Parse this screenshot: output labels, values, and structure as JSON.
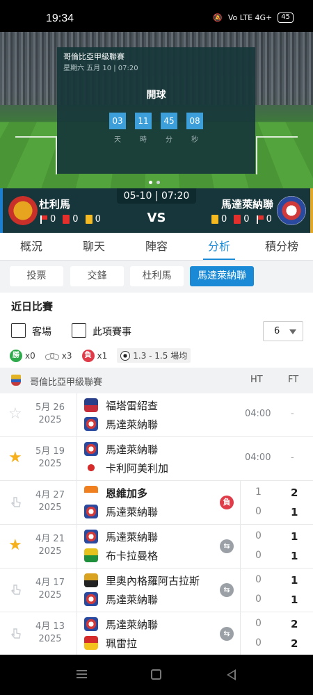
{
  "status": {
    "time": "19:34",
    "battery": "45",
    "signal": "Vo LTE 4G+"
  },
  "hero": {
    "league": "哥倫比亞甲級聯賽",
    "datetime": "星期六 五月 10 | 07:20",
    "kickoff": "開球",
    "countdown": [
      {
        "value": "03",
        "unit": "天"
      },
      {
        "value": "11",
        "unit": "時"
      },
      {
        "value": "45",
        "unit": "分"
      },
      {
        "value": "08",
        "unit": "秒"
      }
    ]
  },
  "match": {
    "date": "05-10 | 07:20",
    "vs": "VS",
    "home": {
      "name": "杜利馬",
      "flags": "0",
      "red": "0",
      "yellow": "0"
    },
    "away": {
      "name": "馬達萊納聯",
      "yellow": "0",
      "red": "0",
      "flags": "0"
    }
  },
  "tabs": [
    "概況",
    "聊天",
    "陣容",
    "分析",
    "積分榜"
  ],
  "subtabs": [
    "投票",
    "交鋒",
    "杜利馬",
    "馬達萊納聯"
  ],
  "recent": {
    "title": "近日比賽",
    "filter_away": "客場",
    "filter_comp": "此項賽事",
    "count": "6",
    "wins": "x0",
    "draws": "x3",
    "losses": "x1",
    "loss_label": "負",
    "win_label": "勝",
    "avg": "1.3 - 1.5 場均"
  },
  "league_header": {
    "name": "哥倫比亞甲級聯賽",
    "ht": "HT",
    "ft": "FT"
  },
  "rows": [
    {
      "month": "5月 26",
      "year": "2025",
      "home": "福塔雷紹查",
      "away": "馬達萊納聯",
      "time": "04:00",
      "ft": "-",
      "star": "empty"
    },
    {
      "month": "5月 19",
      "year": "2025",
      "home": "馬達萊納聯",
      "away": "卡利阿美利加",
      "time": "04:00",
      "ft": "-",
      "star": "filled"
    },
    {
      "month": "4月 27",
      "year": "2025",
      "home": "恩維加多",
      "away": "馬達萊納聯",
      "ht_home": "1",
      "ht_away": "0",
      "ft_home": "2",
      "ft_away": "1",
      "result": "負"
    },
    {
      "month": "4月 21",
      "year": "2025",
      "home": "馬達萊納聯",
      "away": "布卡拉曼格",
      "ht_home": "0",
      "ht_away": "0",
      "ft_home": "1",
      "ft_away": "1",
      "result": "draw"
    },
    {
      "month": "4月 17",
      "year": "2025",
      "home": "里奧內格羅阿古拉斯",
      "away": "馬達萊納聯",
      "ht_home": "0",
      "ht_away": "0",
      "ft_home": "1",
      "ft_away": "1",
      "result": "draw"
    },
    {
      "month": "4月 13",
      "year": "2025",
      "home": "馬達萊納聯",
      "away": "珮雷拉",
      "ht_home": "0",
      "ht_away": "0",
      "ft_home": "2",
      "ft_away": "2",
      "result": "draw"
    }
  ],
  "colors": {
    "accent": "#1a8ad6",
    "dark_teal": "#17363b",
    "win": "#2eaa4c",
    "loss": "#e03b48",
    "star": "#f5b01c"
  }
}
